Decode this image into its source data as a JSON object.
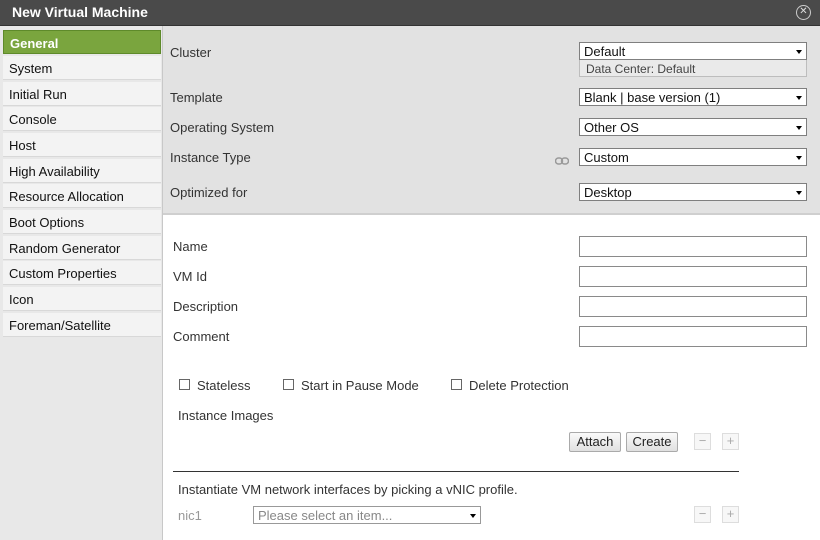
{
  "window": {
    "title": "New Virtual Machine"
  },
  "sidebar": {
    "items": [
      {
        "label": "General"
      },
      {
        "label": "System"
      },
      {
        "label": "Initial Run"
      },
      {
        "label": "Console"
      },
      {
        "label": "Host"
      },
      {
        "label": "High Availability"
      },
      {
        "label": "Resource Allocation"
      },
      {
        "label": "Boot Options"
      },
      {
        "label": "Random Generator"
      },
      {
        "label": "Custom Properties"
      },
      {
        "label": "Icon"
      },
      {
        "label": "Foreman/Satellite"
      }
    ],
    "active_index": 0
  },
  "general": {
    "cluster": {
      "label": "Cluster",
      "value": "Default",
      "data_center": "Data Center: Default"
    },
    "template": {
      "label": "Template",
      "value": "Blank | base version (1)"
    },
    "operating_system": {
      "label": "Operating System",
      "value": "Other OS"
    },
    "instance_type": {
      "label": "Instance Type",
      "value": "Custom"
    },
    "optimized_for": {
      "label": "Optimized for",
      "value": "Desktop"
    }
  },
  "details": {
    "name": {
      "label": "Name",
      "value": ""
    },
    "vm_id": {
      "label": "VM Id",
      "value": ""
    },
    "description": {
      "label": "Description",
      "value": ""
    },
    "comment": {
      "label": "Comment",
      "value": ""
    }
  },
  "options": {
    "stateless": {
      "label": "Stateless",
      "checked": false
    },
    "start_paused": {
      "label": "Start in Pause Mode",
      "checked": false
    },
    "delete_protection": {
      "label": "Delete Protection",
      "checked": false
    }
  },
  "instance_images": {
    "label": "Instance Images",
    "attach": "Attach",
    "create": "Create",
    "minus": "−",
    "plus": "+"
  },
  "network": {
    "heading": "Instantiate VM network interfaces by picking a vNIC profile.",
    "nic_label": "nic1",
    "nic_placeholder": "Please select an item...",
    "minus": "−",
    "plus": "+"
  },
  "icons": {
    "close": "close-icon",
    "link": "link-icon",
    "dropdown": "chevron-down-icon"
  },
  "colors": {
    "titlebar": "#4a4a4a",
    "active_tab": "#7aa53e",
    "top_section": "#e2e2e2"
  }
}
